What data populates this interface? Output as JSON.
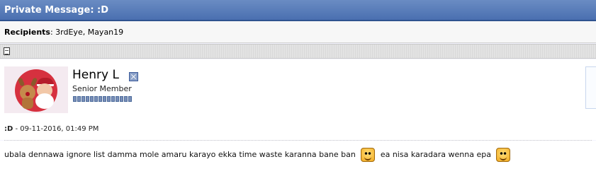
{
  "window": {
    "title": "Private Message: :D"
  },
  "recipients": {
    "label": "Recipients",
    "value": ": 3rdEye, Mayan19"
  },
  "post": {
    "icon": "document-icon",
    "author": {
      "name": "Henry L",
      "status_icon": "offline-status-icon",
      "title": "Senior Member",
      "reputation_pips": 14,
      "avatar": "christmas-reindeer-santa-avatar"
    },
    "subject": ":D",
    "date_separator": " - ",
    "date": "09-11-2016, 01:49 PM",
    "message": {
      "part1": "ubala dennawa ignore list damma mole amaru karayo ekka time waste karanna bane ban",
      "smiley1": "smile-emoticon",
      "part2": "ea nisa karadara wenna epa",
      "smiley2": "smile-emoticon"
    }
  },
  "colors": {
    "title_bar": "#4a6fb0",
    "background": "#f5f5ff"
  }
}
